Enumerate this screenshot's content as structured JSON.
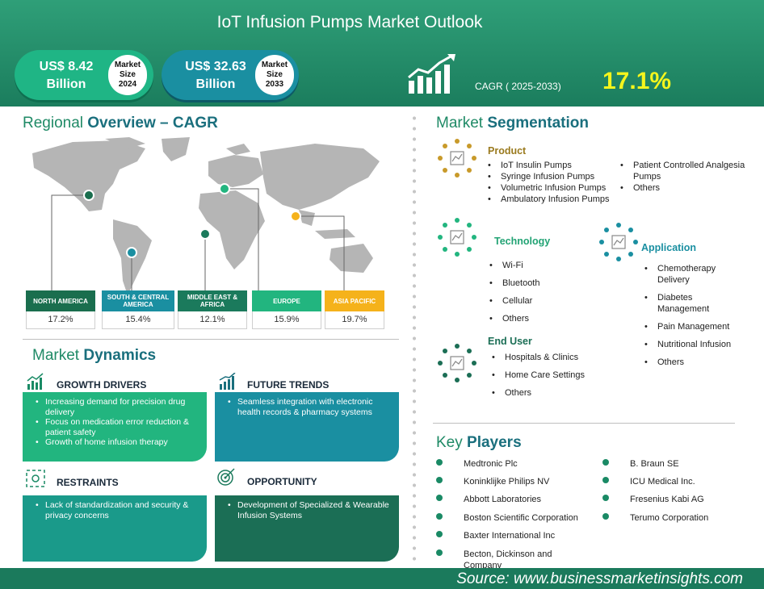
{
  "header": {
    "title": "IoT Infusion Pumps Market Outlook",
    "market_2024": {
      "value": "US$ 8.42",
      "unit": "Billion",
      "label_line1": "Market",
      "label_line2": "Size",
      "year": "2024"
    },
    "market_2033": {
      "value": "US$ 32.63",
      "unit": "Billion",
      "label_line1": "Market",
      "label_line2": "Size",
      "year": "2033"
    },
    "cagr_label": "CAGR ( 2025-2033)",
    "cagr_value": "17.1%"
  },
  "regional": {
    "title_light": "Regional",
    "title_bold": "Overview – CAGR",
    "regions": [
      {
        "name": "NORTH AMERICA",
        "value": "17.2%",
        "color": "#1a6e4e"
      },
      {
        "name": "SOUTH & CENTRAL AMERICA",
        "value": "15.4%",
        "color": "#1a8fa1"
      },
      {
        "name": "MIDDLE EAST & AFRICA",
        "value": "12.1%",
        "color": "#1b7a5c"
      },
      {
        "name": "EUROPE",
        "value": "15.9%",
        "color": "#22b57f"
      },
      {
        "name": "ASIA PACIFIC",
        "value": "19.7%",
        "color": "#f5b21b"
      }
    ]
  },
  "dynamics": {
    "title_light": "Market",
    "title_bold": "Dynamics",
    "growth_drivers": {
      "title": "GROWTH DRIVERS",
      "items": [
        "Increasing demand for precision drug delivery",
        "Focus on medication error reduction & patient safety",
        "Growth of home infusion therapy"
      ]
    },
    "future_trends": {
      "title": "FUTURE TRENDS",
      "items": [
        "Seamless integration with electronic health records & pharmacy systems"
      ]
    },
    "restraints": {
      "title": "RESTRAINTS",
      "items": [
        "Lack of standardization and security & privacy concerns"
      ]
    },
    "opportunity": {
      "title": "OPPORTUNITY",
      "items": [
        "Development of Specialized & Wearable Infusion Systems"
      ]
    }
  },
  "segmentation": {
    "title_light": "Market",
    "title_bold": "Segmentation",
    "product": {
      "title": "Product",
      "col1": [
        "IoT Insulin Pumps",
        "Syringe Infusion Pumps",
        "Volumetric Infusion Pumps",
        "Ambulatory Infusion Pumps"
      ],
      "col2": [
        "Patient Controlled Analgesia Pumps",
        "Others"
      ]
    },
    "technology": {
      "title": "Technology",
      "items": [
        "Wi-Fi",
        "Bluetooth",
        "Cellular",
        "Others"
      ]
    },
    "application": {
      "title": "Application",
      "items": [
        "Chemotherapy Delivery",
        "Diabetes Management",
        "Pain Management",
        "Nutritional Infusion",
        "Others"
      ]
    },
    "end_user": {
      "title": "End User",
      "items": [
        "Hospitals & Clinics",
        "Home Care Settings",
        "Others"
      ]
    }
  },
  "key_players": {
    "title_light": "Key",
    "title_bold": "Players",
    "col1": [
      "Medtronic Plc",
      "Koninklijke Philips NV",
      "Abbott Laboratories",
      "Boston Scientific Corporation",
      "Baxter International Inc",
      "Becton, Dickinson and Company"
    ],
    "col2": [
      "B. Braun SE",
      "ICU Medical Inc.",
      "Fresenius Kabi AG",
      "Terumo Corporation"
    ]
  },
  "footer": {
    "source": "Source:  www.businessmarketinsights.com"
  }
}
